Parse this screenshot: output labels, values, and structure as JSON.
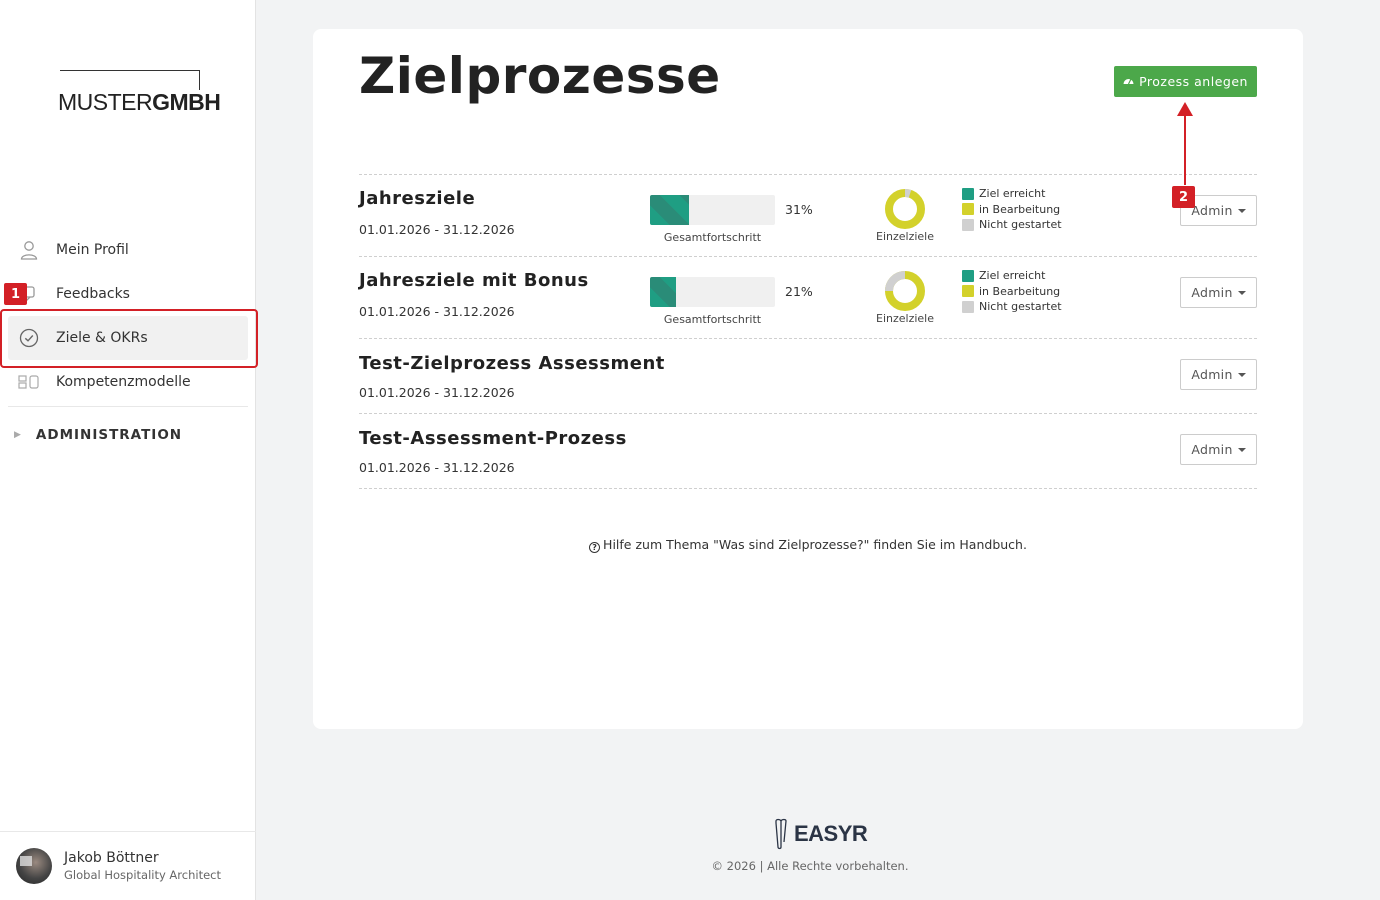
{
  "sidebar": {
    "logo": {
      "part1": "MUSTER",
      "part2": "GMBH"
    },
    "items": [
      {
        "label": "Mein Profil",
        "icon": "user-icon"
      },
      {
        "label": "Feedbacks",
        "icon": "feedback-icon"
      },
      {
        "label": "Ziele & OKRs",
        "icon": "check-circle-icon",
        "active": true
      },
      {
        "label": "Kompetenzmodelle",
        "icon": "grid-icon"
      }
    ],
    "admin_label": "ADMINISTRATION",
    "user": {
      "name": "Jakob Böttner",
      "role": "Global Hospitality Architect"
    }
  },
  "main": {
    "title": "Zielprozesse",
    "create_button": "Prozess anlegen",
    "processes": [
      {
        "title": "Jahresziele",
        "date": "01.01.2026 - 31.12.2026",
        "progress": 31,
        "progress_label": "31%",
        "progress_caption": "Gesamtfortschritt",
        "donut_caption": "Einzelziele",
        "admin": "Admin"
      },
      {
        "title": "Jahresziele mit Bonus",
        "date": "01.01.2026 - 31.12.2026",
        "progress": 21,
        "progress_label": "21%",
        "progress_caption": "Gesamtfortschritt",
        "donut_caption": "Einzelziele",
        "admin": "Admin"
      },
      {
        "title": "Test-Zielprozess Assessment",
        "date": "01.01.2026 - 31.12.2026",
        "admin": "Admin"
      },
      {
        "title": "Test-Assessment-Prozess",
        "date": "01.01.2026 - 31.12.2026",
        "admin": "Admin"
      }
    ],
    "legend": [
      "Ziel erreicht",
      "in Bearbeitung",
      "Nicht gestartet"
    ],
    "help_text": "Hilfe zum Thema \"Was sind Zielprozesse?\" finden Sie im Handbuch."
  },
  "footer": {
    "brand": "EASYR",
    "copyright": "© 2026 | Alle Rechte vorbehalten."
  },
  "annotations": {
    "marker1": "1",
    "marker2": "2"
  },
  "colors": {
    "accent_green": "#4ca84a",
    "goal_reached": "#1f9e83",
    "in_progress": "#d3d12b",
    "not_started": "#d0d0d0",
    "annotation_red": "#d32026"
  }
}
